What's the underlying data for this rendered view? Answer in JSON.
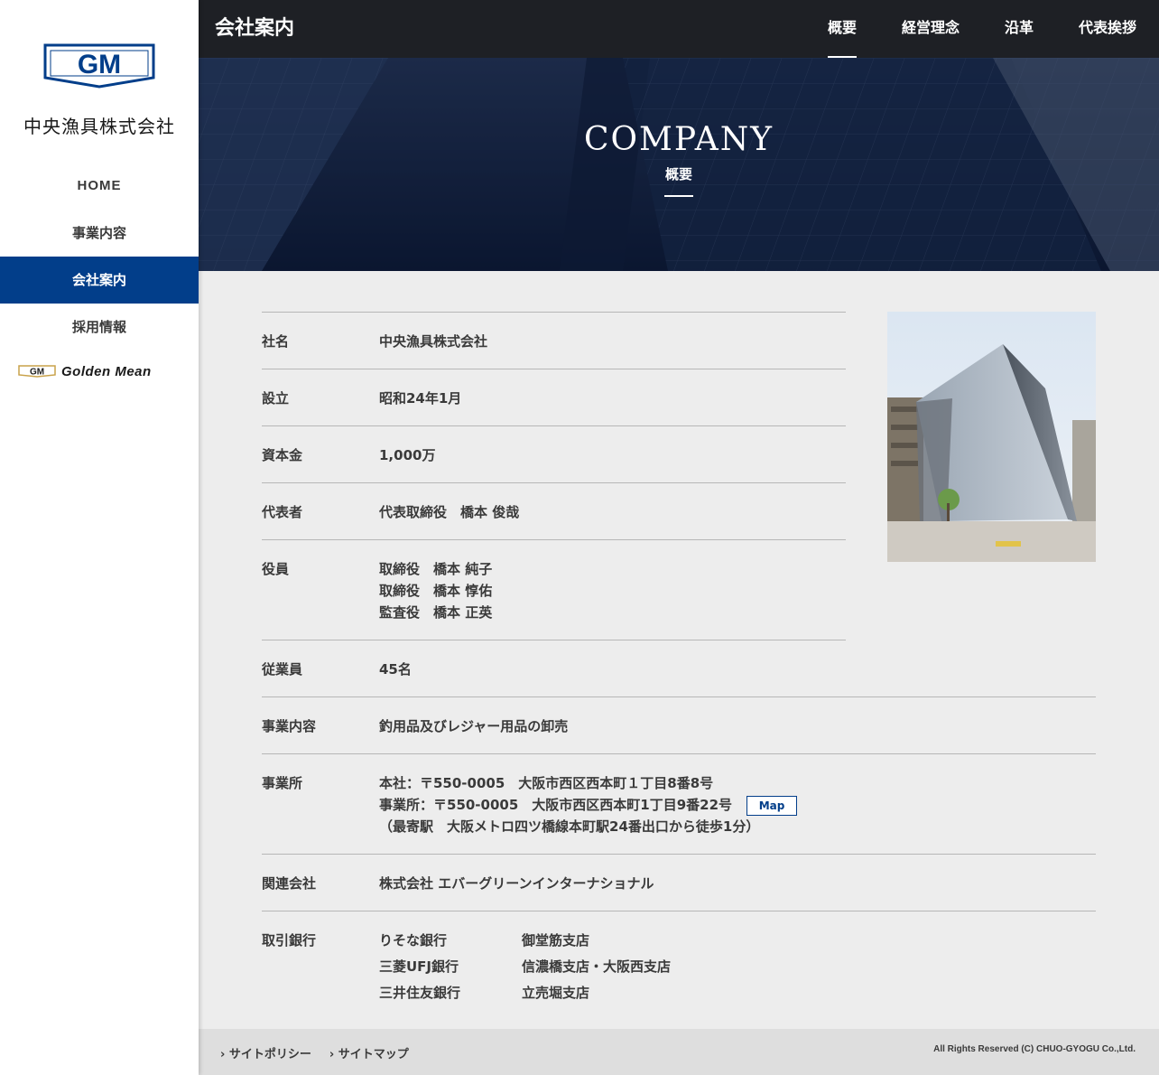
{
  "sidebar": {
    "logo_text": "GM",
    "company_name": "中央漁具株式会社",
    "nav": [
      "HOME",
      "事業内容",
      "会社案内",
      "採用情報"
    ],
    "banner_text": "Golden Mean"
  },
  "topbar": {
    "title": "会社案内",
    "nav": [
      "概要",
      "経営理念",
      "沿革",
      "代表挨拶"
    ]
  },
  "hero": {
    "title": "COMPANY",
    "subtitle": "概要"
  },
  "info": {
    "company": {
      "label": "社名",
      "value": "中央漁具株式会社"
    },
    "founded": {
      "label": "設立",
      "value": "昭和24年1月"
    },
    "capital": {
      "label": "資本金",
      "value": "1,000万"
    },
    "representative": {
      "label": "代表者",
      "value": "代表取締役　橋本 俊哉"
    },
    "officers": {
      "label": "役員",
      "lines": [
        "取締役　橋本 純子",
        "取締役　橋本 惇佑",
        "監査役　橋本 正英"
      ]
    },
    "employees": {
      "label": "従業員",
      "value": "45名"
    },
    "business": {
      "label": "事業内容",
      "value": "釣用品及びレジャー用品の卸売"
    },
    "offices": {
      "label": "事業所",
      "lines": [
        "本社：〒550-0005　大阪市西区西本町１丁目8番8号",
        "事業所：〒550-0005　大阪市西区西本町1丁目9番22号",
        "（最寄駅　大阪メトロ四ツ橋線本町駅24番出口から徒歩1分）"
      ],
      "map_label": "Map"
    },
    "related": {
      "label": "関連会社",
      "value": "株式会社 エバーグリーンインターナショナル"
    },
    "banks": {
      "label": "取引銀行",
      "rows": [
        [
          "りそな銀行",
          "御堂筋支店"
        ],
        [
          "三菱UFJ銀行",
          "信濃橋支店・大阪西支店"
        ],
        [
          "三井住友銀行",
          "立売堀支店"
        ]
      ]
    }
  },
  "footer": {
    "links": [
      "サイトポリシー",
      "サイトマップ"
    ],
    "copyright": "All Rights Reserved (C) CHUO-GYOGU Co.,Ltd."
  },
  "colors": {
    "accent": "#023e8a",
    "topbar": "#1e2025",
    "content_bg": "#ededed",
    "footer_bg": "#dedede"
  }
}
